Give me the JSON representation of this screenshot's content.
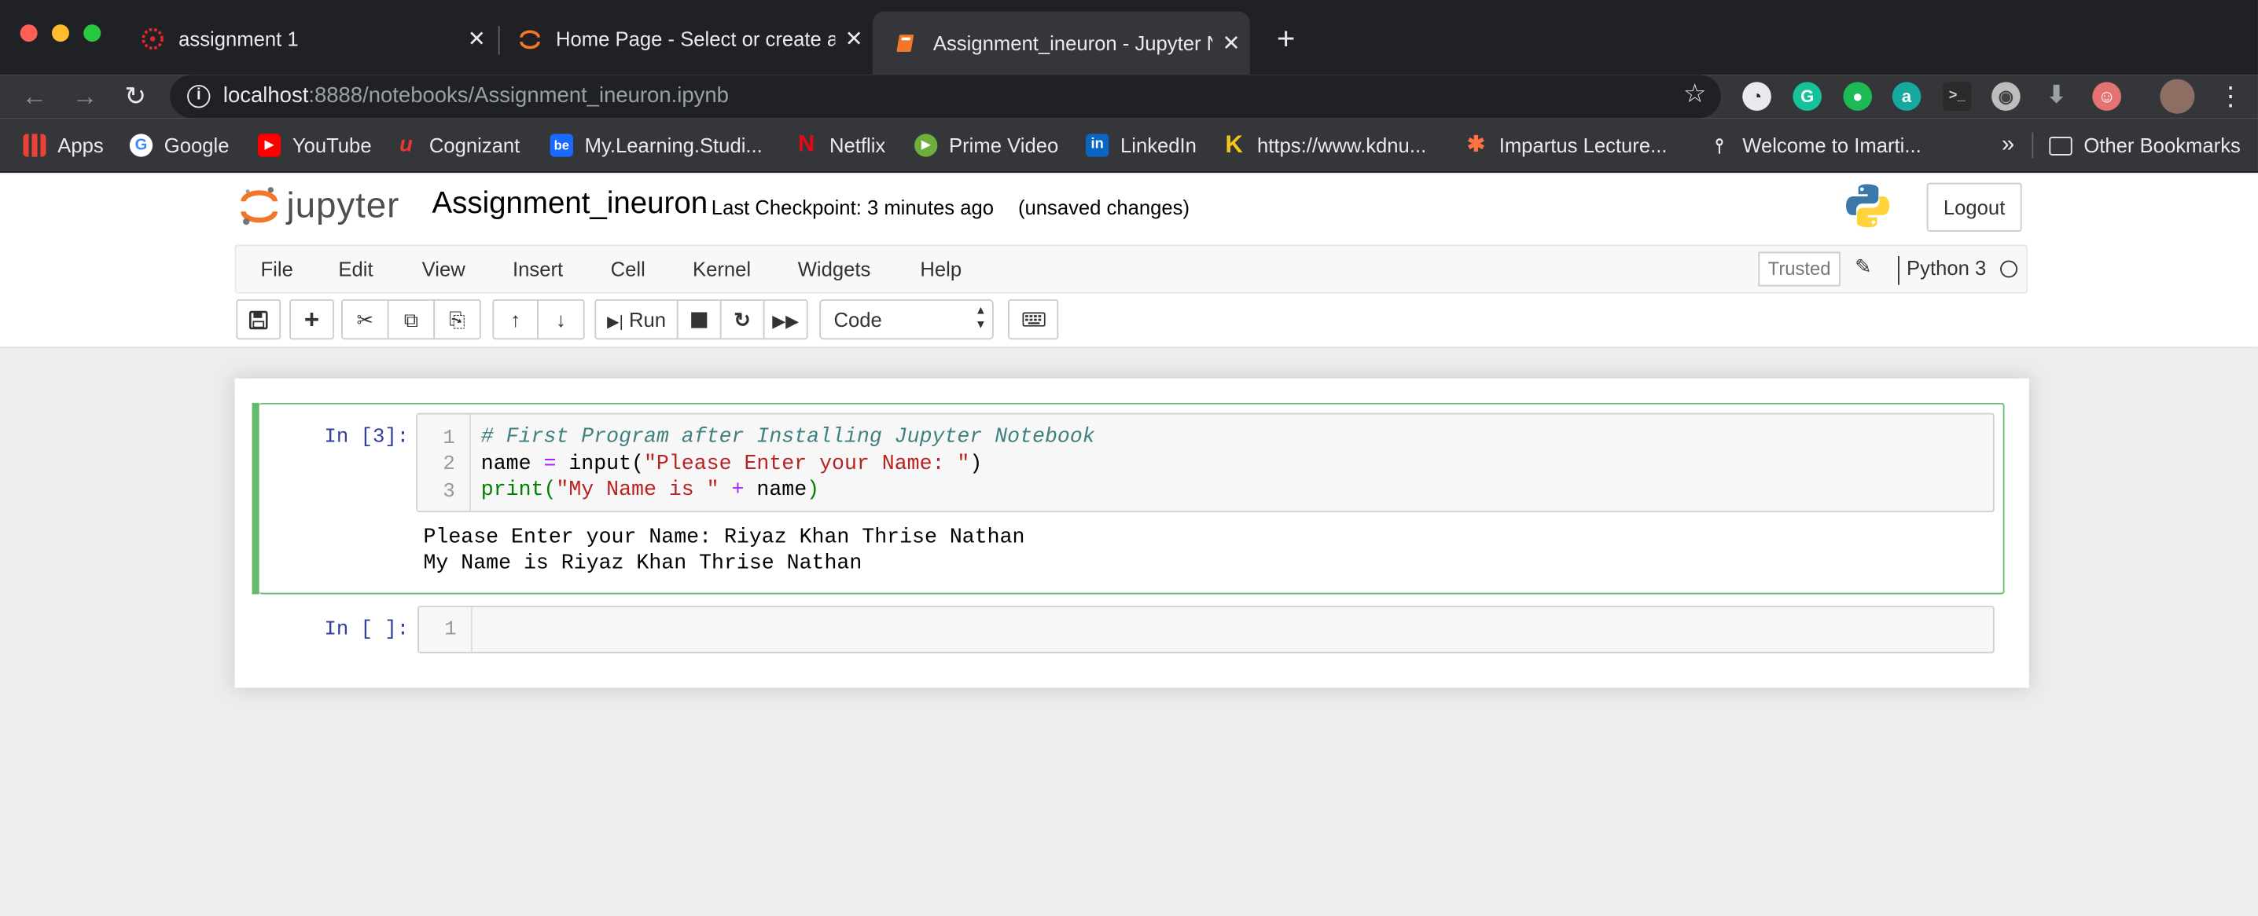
{
  "browser": {
    "tabs": [
      {
        "title": "assignment 1",
        "close": "✕"
      },
      {
        "title": "Home Page - Select or create a",
        "close": "✕"
      },
      {
        "title": "Assignment_ineuron - Jupyter N",
        "close": "✕"
      }
    ],
    "new_tab": "+",
    "url_host": "localhost",
    "url_rest": ":8888/notebooks/Assignment_ineuron.ipynb",
    "bookmarks": [
      "Apps",
      "Google",
      "YouTube",
      "Cognizant",
      "My.Learning.Studi...",
      "Netflix",
      "Prime Video",
      "LinkedIn",
      "https://www.kdnu...",
      "Impartus Lecture...",
      "Welcome to Imarti..."
    ],
    "more_bookmarks": "»",
    "other_bookmarks": "Other Bookmarks"
  },
  "jupyter": {
    "logo_text": "jupyter",
    "notebook_name": "Assignment_ineuron",
    "checkpoint": "Last Checkpoint: 3 minutes ago",
    "unsaved": "(unsaved changes)",
    "logout": "Logout",
    "menu": [
      "File",
      "Edit",
      "View",
      "Insert",
      "Cell",
      "Kernel",
      "Widgets",
      "Help"
    ],
    "trusted": "Trusted",
    "kernel_name": "Python 3",
    "run_label": "Run",
    "cell_type": "Code"
  },
  "cells": [
    {
      "prompt": "In [3]:",
      "line_numbers": [
        "1",
        "2",
        "3"
      ],
      "code": {
        "l1": "# First Program after Installing Jupyter Notebook",
        "l2_a": "name ",
        "l2_op": "=",
        "l2_b": " input(",
        "l2_str": "\"Please Enter your Name: \"",
        "l2_c": ")",
        "l3_fn": "print(",
        "l3_str": "\"My Name is \"",
        "l3_a": " ",
        "l3_op": "+",
        "l3_b": " name",
        "l3_c": ")"
      },
      "output": [
        "Please Enter your Name: Riyaz Khan Thrise Nathan",
        "My Name is Riyaz Khan Thrise Nathan"
      ]
    },
    {
      "prompt": "In [ ]:",
      "line_numbers": [
        "1"
      ]
    }
  ],
  "colors": {
    "chrome_dark": "#202124",
    "chrome_tab": "#35363a",
    "selected_cell_border": "#66bb6a",
    "prompt": "#303f9f"
  }
}
